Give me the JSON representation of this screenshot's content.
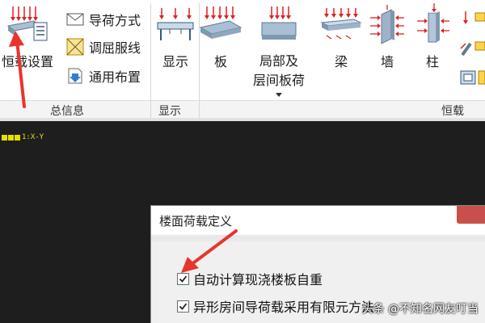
{
  "ribbon": {
    "group_general": {
      "label": "总信息",
      "set_button": "恒载设置",
      "small_buttons": [
        {
          "label": "导荷方式",
          "icon": "envelope-icon"
        },
        {
          "label": "调屈服线",
          "icon": "yield-line-icon"
        },
        {
          "label": "通用布置",
          "icon": "download-arrow-icon"
        }
      ]
    },
    "group_display": {
      "label": "显示",
      "button": "显示"
    },
    "group_dead_load": {
      "label": "恒载",
      "buttons": [
        {
          "label": "板"
        },
        {
          "label_line1": "局部及",
          "label_line2": "层间板荷"
        },
        {
          "label": "梁"
        },
        {
          "label": "墙"
        },
        {
          "label": "柱"
        }
      ]
    }
  },
  "workspace": {
    "view_label": "1:X-Y"
  },
  "dialog": {
    "title": "楼面荷载定义",
    "options": [
      {
        "label": "自动计算现浇楼板自重",
        "checked": true
      },
      {
        "label": "异形房间导荷载采用有限元方法",
        "checked": true
      }
    ]
  },
  "watermark": "头条 @不知名网友叮当",
  "colors": {
    "load_arrow": "#e02020",
    "slab": "#9fb3c8",
    "annotation": "#e8352c",
    "view_tab": "#e3e000"
  }
}
